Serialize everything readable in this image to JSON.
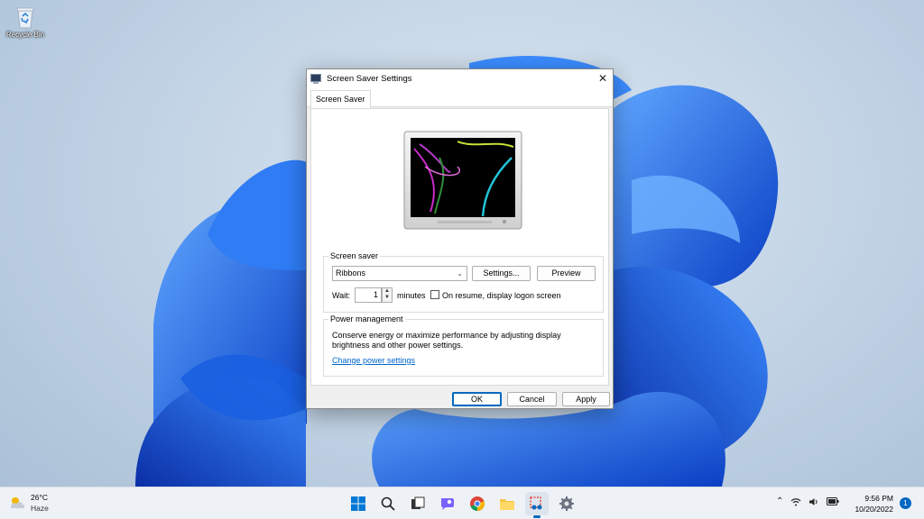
{
  "desktop": {
    "recycle_bin_label": "Recycle Bin"
  },
  "dialog": {
    "title": "Screen Saver Settings",
    "close_glyph": "✕",
    "tab_label": "Screen Saver",
    "screen_saver_group_label": "Screen saver",
    "screen_saver_selected": "Ribbons",
    "settings_button": "Settings...",
    "preview_button": "Preview",
    "wait_label": "Wait:",
    "wait_value": "1",
    "minutes_label": "minutes",
    "resume_checkbox_label": "On resume, display logon screen",
    "resume_checked": false,
    "power_group_label": "Power management",
    "power_text": "Conserve energy or maximize performance by adjusting display brightness and other power settings.",
    "power_link": "Change power settings",
    "ok_button": "OK",
    "cancel_button": "Cancel",
    "apply_button": "Apply"
  },
  "taskbar": {
    "weather_temp": "26°C",
    "weather_condition": "Haze",
    "apps": [
      "start-icon",
      "search-icon",
      "task-view-icon",
      "chat-icon",
      "chrome-icon",
      "file-explorer-icon",
      "snipping-tool-icon",
      "settings-icon"
    ],
    "time": "9:56 PM",
    "date": "10/20/2022",
    "notification_count": "1"
  },
  "colors": {
    "accent": "#0067c0",
    "link": "#0066cc",
    "wallpaper_blue": "#1e6bf0"
  }
}
